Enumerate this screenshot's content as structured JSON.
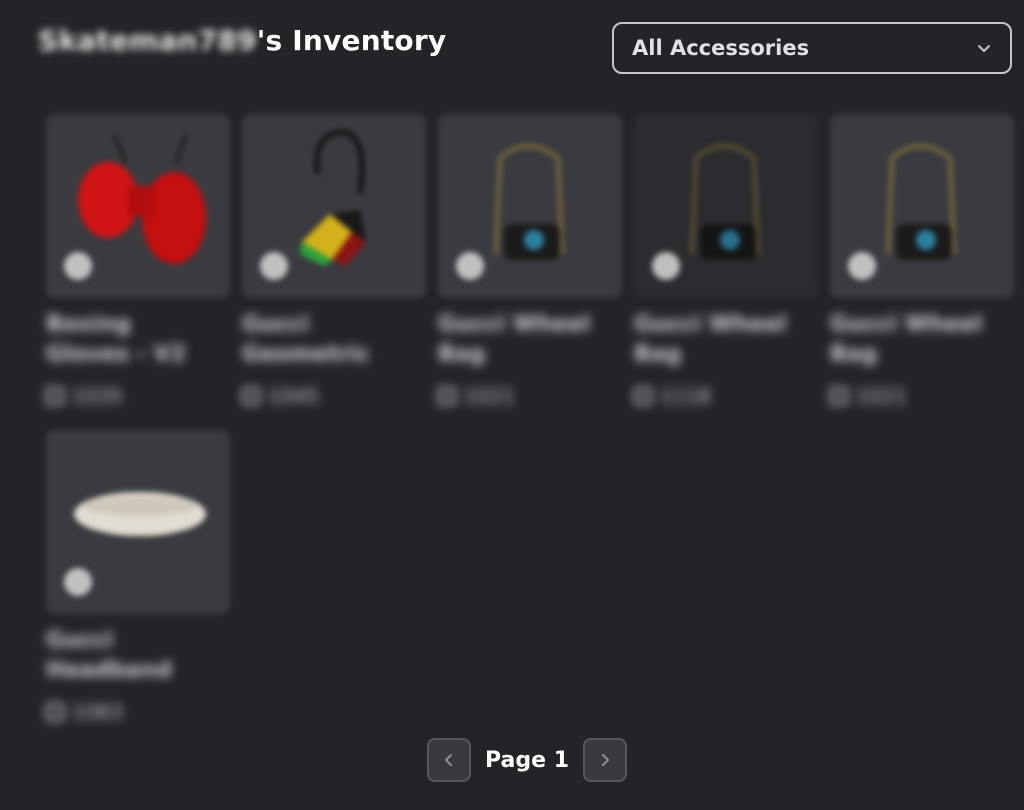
{
  "header": {
    "username": "Skateman789",
    "title_suffix": "'s Inventory"
  },
  "filter": {
    "selected": "All Accessories"
  },
  "items": [
    {
      "name": "Boxing Gloves - V2",
      "price": "1035",
      "art": "gloves"
    },
    {
      "name": "Gucci Geometric",
      "price": "1045",
      "art": "geo"
    },
    {
      "name": "Gucci Wheel Bag",
      "price": "1021",
      "art": "bag"
    },
    {
      "name": "Gucci Wheel Bag",
      "price": "1118",
      "art": "bag"
    },
    {
      "name": "Gucci Wheel Bag",
      "price": "1021",
      "art": "bag"
    },
    {
      "name": "Gucci Headband",
      "price": "1083",
      "art": "headband"
    }
  ],
  "pagination": {
    "label": "Page 1",
    "prev": "previous-page",
    "next": "next-page"
  },
  "colors": {
    "background": "#232428",
    "tile": "#3a3b40",
    "accent_red": "#d11414",
    "accent_yellow": "#d4b11a"
  }
}
